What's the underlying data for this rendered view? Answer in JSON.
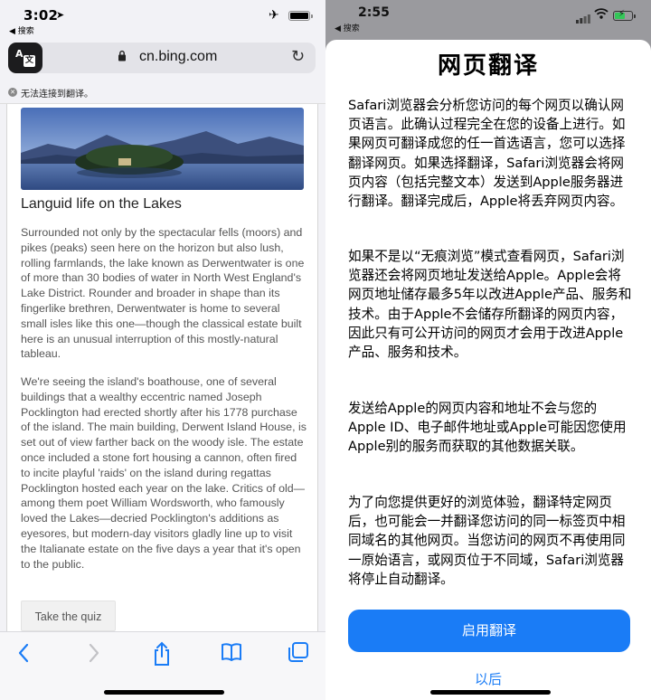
{
  "left": {
    "status": {
      "time": "3:02",
      "back_label": "◀ 搜索"
    },
    "address_bar": {
      "url": "cn.bing.com"
    },
    "notice": {
      "text": "无法连接到翻译。"
    },
    "article": {
      "title": "Languid life on the Lakes",
      "paragraph_1": "Surrounded not only by the spectacular fells (moors) and pikes (peaks) seen here on the horizon but also lush, rolling farmlands, the lake known as Derwentwater is one of more than 30 bodies of water in North West England's Lake District. Rounder and broader in shape than its fingerlike brethren, Derwentwater is home to several small isles like this one—though the classical estate built here is an unusual interruption of this mostly-natural tableau.",
      "paragraph_2": "We're seeing the island's boathouse, one of several buildings that a wealthy eccentric named Joseph Pocklington had erected shortly after his 1778 purchase of the island. The main building, Derwent Island House, is set out of view farther back on the woody isle. The estate once included a stone fort housing a cannon, often fired to incite playful 'raids' on the island during regattas Pocklington hosted each year on the lake. Critics of old—among them poet William Wordsworth, who famously loved the Lakes—decried Pocklington's additions as eyesores, but modern-day visitors gladly line up to visit the Italianate estate on the five days a year that it's open to the public.",
      "quiz_button": "Take the quiz"
    },
    "toolbar": {
      "icons": [
        "back-arrow-icon",
        "forward-arrow-icon",
        "share-icon",
        "bookmarks-icon",
        "tabs-icon"
      ]
    }
  },
  "right": {
    "status": {
      "time": "2:55",
      "back_label": "◀ 搜索"
    },
    "sheet": {
      "title": "网页翻译",
      "paragraph_1": "Safari浏览器会分析您访问的每个网页以确认网页语言。此确认过程完全在您的设备上进行。如果网页可翻译成您的任一首选语言，您可以选择翻译网页。如果选择翻译，Safari浏览器会将网页内容（包括完整文本）发送到Apple服务器进行翻译。翻译完成后，Apple将丢弃网页内容。",
      "paragraph_2": "如果不是以“无痕浏览”模式查看网页，Safari浏览器还会将网页地址发送给Apple。Apple会将网页地址储存最多5年以改进Apple产品、服务和技术。由于Apple不会储存所翻译的网页内容，因此只有可公开访问的网页才会用于改进Apple产品、服务和技术。",
      "paragraph_3": "发送给Apple的网页内容和地址不会与您的Apple ID、电子邮件地址或Apple可能因您使用Apple别的服务而获取的其他数据关联。",
      "paragraph_4": "为了向您提供更好的浏览体验，翻译特定网页后，也可能会一并翻译您访问的同一标签页中相同域名的其他网页。当您访问的网页不再使用同一原始语言，或网页位于不同域，Safari浏览器将停止自动翻译。",
      "enable_button": "启用翻译",
      "later_button": "以后"
    }
  },
  "colors": {
    "accent": "#1a7cf6",
    "battery_green": "#34c759"
  }
}
